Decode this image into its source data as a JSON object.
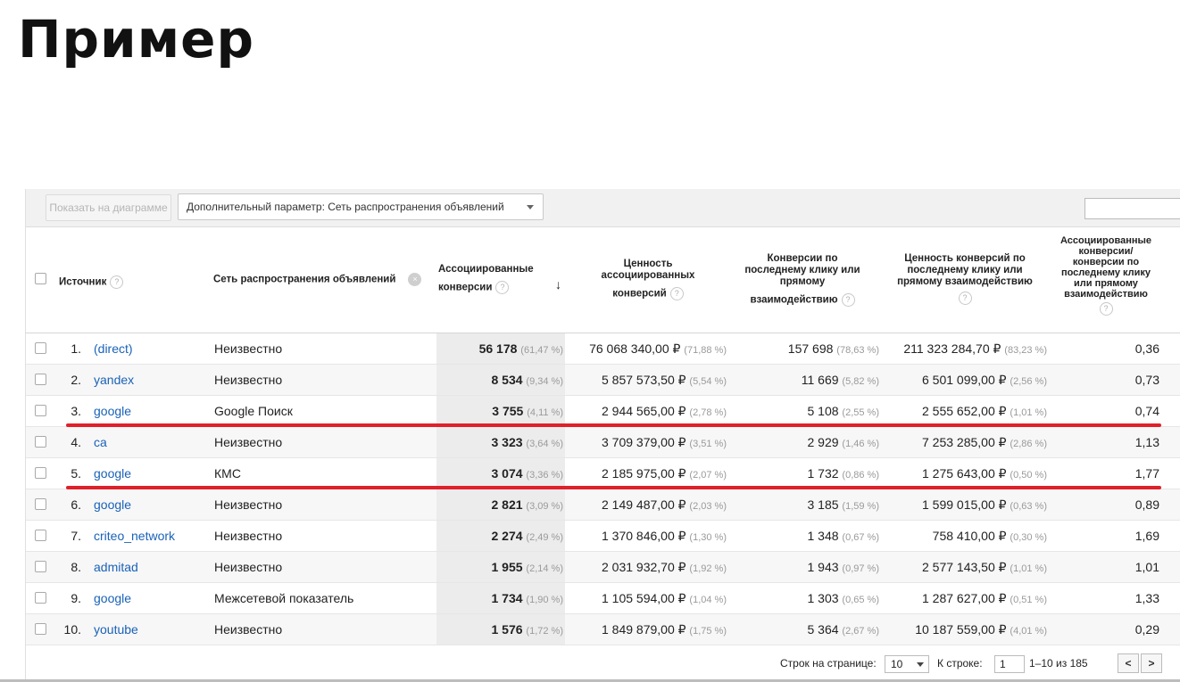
{
  "slide": {
    "title": "Пример"
  },
  "toolbar": {
    "chart_button": "Показать на диаграмме",
    "secondary_dimension": "Дополнительный параметр: Сеть распространения объявлений"
  },
  "help_glyph": "?",
  "columns": {
    "source": "Источник",
    "network": "Сеть распространения объявлений",
    "assisted_conv": [
      "Ассоциированные",
      "конверсии"
    ],
    "assisted_value": [
      "Ценность",
      "ассоциированных",
      "конверсий"
    ],
    "last_click_conv": [
      "Конверсии по",
      "последнему клику или",
      "прямому",
      "взаимодействию"
    ],
    "last_click_value": [
      "Ценность конверсий по",
      "последнему клику или",
      "прямому взаимодействию"
    ],
    "ratio": [
      "Ассоциированные",
      "конверсии/",
      "конверсии по",
      "последнему клику",
      "или прямому",
      "взаимодействию"
    ]
  },
  "rows": [
    {
      "idx": "1.",
      "source": "(direct)",
      "network": "Неизвестно",
      "assisted": "56 178",
      "assisted_pct": "(61,47 %)",
      "assisted_value": "76 068 340,00 ₽",
      "assisted_value_pct": "(71,88 %)",
      "last": "157 698",
      "last_pct": "(78,63 %)",
      "last_value": "211 323 284,70 ₽",
      "last_value_pct": "(83,23 %)",
      "ratio": "0,36"
    },
    {
      "idx": "2.",
      "source": "yandex",
      "network": "Неизвестно",
      "assisted": "8 534",
      "assisted_pct": "(9,34 %)",
      "assisted_value": "5 857 573,50 ₽",
      "assisted_value_pct": "(5,54 %)",
      "last": "11 669",
      "last_pct": "(5,82 %)",
      "last_value": "6 501 099,00 ₽",
      "last_value_pct": "(2,56 %)",
      "ratio": "0,73"
    },
    {
      "idx": "3.",
      "source": "google",
      "network": "Google Поиск",
      "assisted": "3 755",
      "assisted_pct": "(4,11 %)",
      "assisted_value": "2 944 565,00 ₽",
      "assisted_value_pct": "(2,78 %)",
      "last": "5 108",
      "last_pct": "(2,55 %)",
      "last_value": "2 555 652,00 ₽",
      "last_value_pct": "(1,01 %)",
      "ratio": "0,74"
    },
    {
      "idx": "4.",
      "source": "ca",
      "network": "Неизвестно",
      "assisted": "3 323",
      "assisted_pct": "(3,64 %)",
      "assisted_value": "3 709 379,00 ₽",
      "assisted_value_pct": "(3,51 %)",
      "last": "2 929",
      "last_pct": "(1,46 %)",
      "last_value": "7 253 285,00 ₽",
      "last_value_pct": "(2,86 %)",
      "ratio": "1,13"
    },
    {
      "idx": "5.",
      "source": "google",
      "network": "КМС",
      "assisted": "3 074",
      "assisted_pct": "(3,36 %)",
      "assisted_value": "2 185 975,00 ₽",
      "assisted_value_pct": "(2,07 %)",
      "last": "1 732",
      "last_pct": "(0,86 %)",
      "last_value": "1 275 643,00 ₽",
      "last_value_pct": "(0,50 %)",
      "ratio": "1,77"
    },
    {
      "idx": "6.",
      "source": "google",
      "network": "Неизвестно",
      "assisted": "2 821",
      "assisted_pct": "(3,09 %)",
      "assisted_value": "2 149 487,00 ₽",
      "assisted_value_pct": "(2,03 %)",
      "last": "3 185",
      "last_pct": "(1,59 %)",
      "last_value": "1 599 015,00 ₽",
      "last_value_pct": "(0,63 %)",
      "ratio": "0,89"
    },
    {
      "idx": "7.",
      "source": "criteo_network",
      "network": "Неизвестно",
      "assisted": "2 274",
      "assisted_pct": "(2,49 %)",
      "assisted_value": "1 370 846,00 ₽",
      "assisted_value_pct": "(1,30 %)",
      "last": "1 348",
      "last_pct": "(0,67 %)",
      "last_value": "758 410,00 ₽",
      "last_value_pct": "(0,30 %)",
      "ratio": "1,69"
    },
    {
      "idx": "8.",
      "source": "admitad",
      "network": "Неизвестно",
      "assisted": "1 955",
      "assisted_pct": "(2,14 %)",
      "assisted_value": "2 031 932,70 ₽",
      "assisted_value_pct": "(1,92 %)",
      "last": "1 943",
      "last_pct": "(0,97 %)",
      "last_value": "2 577 143,50 ₽",
      "last_value_pct": "(1,01 %)",
      "ratio": "1,01"
    },
    {
      "idx": "9.",
      "source": "google",
      "network": "Межсетевой показатель",
      "assisted": "1 734",
      "assisted_pct": "(1,90 %)",
      "assisted_value": "1 105 594,00 ₽",
      "assisted_value_pct": "(1,04 %)",
      "last": "1 303",
      "last_pct": "(0,65 %)",
      "last_value": "1 287 627,00 ₽",
      "last_value_pct": "(0,51 %)",
      "ratio": "1,33"
    },
    {
      "idx": "10.",
      "source": "youtube",
      "network": "Неизвестно",
      "assisted": "1 576",
      "assisted_pct": "(1,72 %)",
      "assisted_value": "1 849 879,00 ₽",
      "assisted_value_pct": "(1,75 %)",
      "last": "5 364",
      "last_pct": "(2,67 %)",
      "last_value": "10 187 559,00 ₽",
      "last_value_pct": "(4,01 %)",
      "ratio": "0,29"
    }
  ],
  "highlighted_rows": [
    3,
    5
  ],
  "highlight_color": "#e0202a",
  "link_color": "#1a62b8",
  "footer": {
    "rows_per_page_label": "Строк на странице:",
    "rows_per_page_value": "10",
    "goto_label": "К строке:",
    "goto_value": "1",
    "range": "1–10 из 185",
    "prev": "<",
    "next": ">"
  }
}
